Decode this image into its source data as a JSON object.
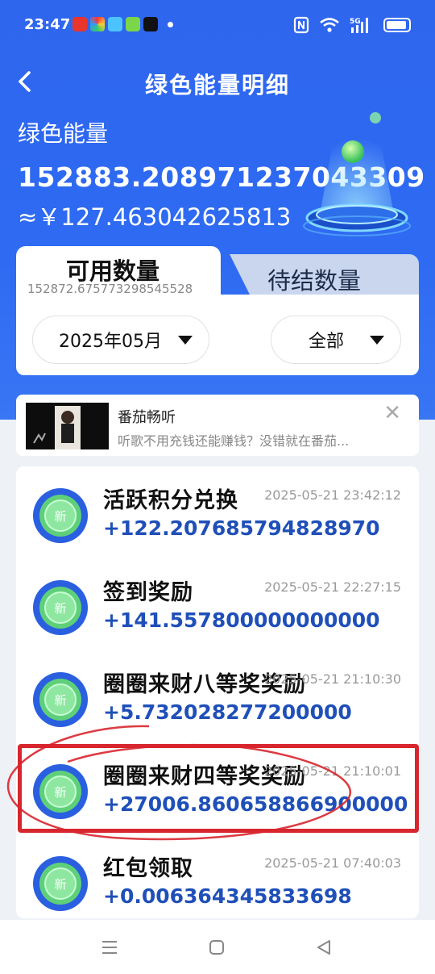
{
  "status_bar": {
    "time": "23:47",
    "signal_label": "5G"
  },
  "header": {
    "title": "绿色能量明细",
    "energy_label": "绿色能量",
    "energy_value": "152883.208971237043309",
    "cny_value": "≈￥127.463042625813"
  },
  "tabs": {
    "active_label": "可用数量",
    "active_value": "152872.675773298545528",
    "inactive_label": "待结数量"
  },
  "filters": {
    "month": "2025年05月",
    "type": "全部"
  },
  "ad": {
    "title": "番茄畅听",
    "description": "听歌不用充钱还能赚钱？没错就在番茄..."
  },
  "records": [
    {
      "title": "活跃积分兑换",
      "time": "2025-05-21 23:42:12",
      "amount": "+122.207685794828970"
    },
    {
      "title": "签到奖励",
      "time": "2025-05-21 22:27:15",
      "amount": "+141.557800000000000"
    },
    {
      "title": "圈圈来财八等奖奖励",
      "time": "2025-05-21 21:10:30",
      "amount": "+5.732028277200000"
    },
    {
      "title": "圈圈来财四等奖奖励",
      "time": "2025-05-21 21:10:01",
      "amount": "+27006.860658866900000"
    },
    {
      "title": "红包领取",
      "time": "2025-05-21 07:40:03",
      "amount": "+0.006364345833698"
    }
  ],
  "colors": {
    "header_blue": "#2f66ee",
    "amount_blue": "#1f4fb8",
    "highlight_red": "#d8262e"
  }
}
